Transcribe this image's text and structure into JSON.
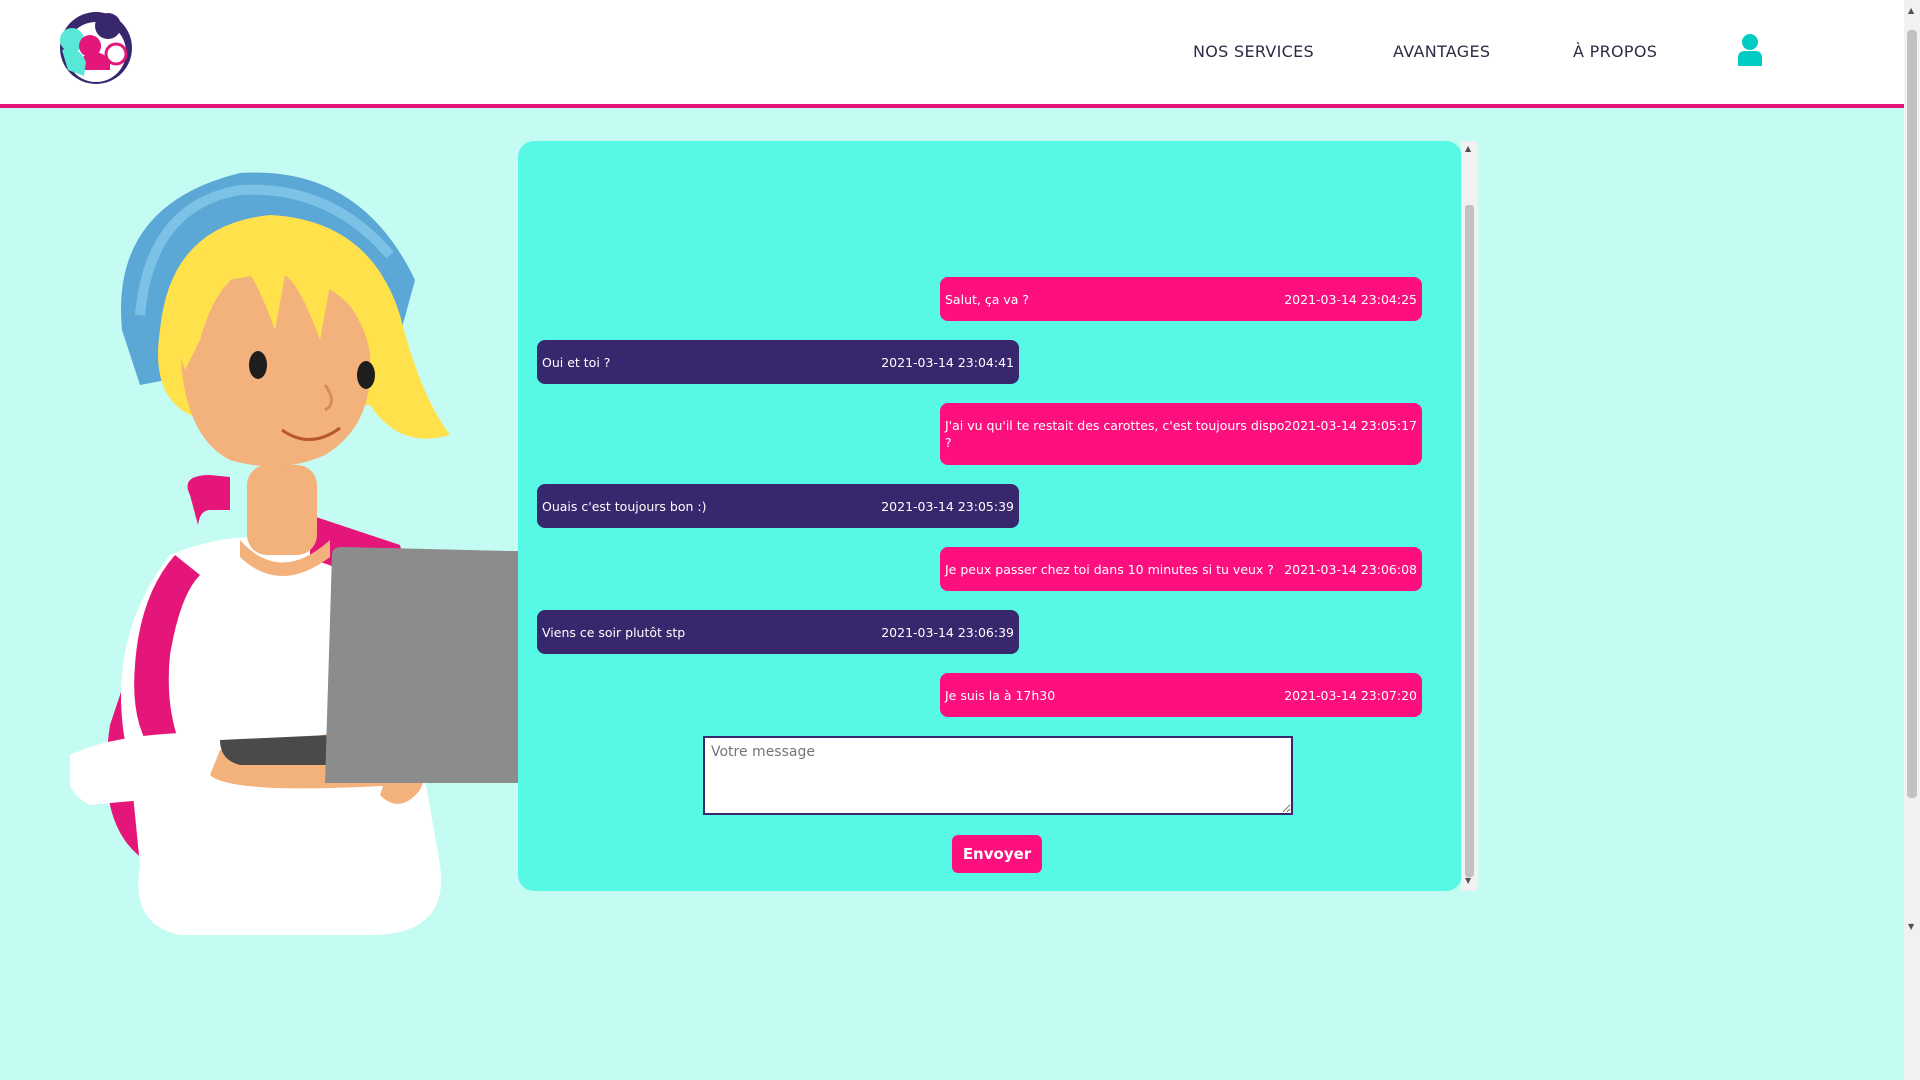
{
  "header": {
    "nav": {
      "services": "NOS SERVICES",
      "avantages": "AVANTAGES",
      "apropos": "À PROPOS"
    },
    "user_icon": "user-icon",
    "logo_icon": "app-logo"
  },
  "chat": {
    "messages": [
      {
        "direction": "sent",
        "text": "Salut, ça va ?",
        "time": "2021-03-14 23:04:25"
      },
      {
        "direction": "received",
        "text": "Oui et toi ?",
        "time": "2021-03-14 23:04:41"
      },
      {
        "direction": "sent",
        "text": "J'ai vu qu'il te restait des carottes, c'est toujours dispo ?",
        "time": "2021-03-14 23:05:17"
      },
      {
        "direction": "received",
        "text": "Ouais c'est toujours bon :)",
        "time": "2021-03-14 23:05:39"
      },
      {
        "direction": "sent",
        "text": "Je peux passer chez toi dans 10 minutes si tu veux ?",
        "time": "2021-03-14 23:06:08"
      },
      {
        "direction": "received",
        "text": "Viens ce soir plutôt stp",
        "time": "2021-03-14 23:06:39"
      },
      {
        "direction": "sent",
        "text": "Je suis la à 17h30",
        "time": "2021-03-14 23:07:20"
      }
    ],
    "input_placeholder": "Votre message",
    "send_label": "Envoyer"
  },
  "colors": {
    "accent_pink": "#fe0f7e",
    "accent_purple": "#38276d",
    "panel_cyan": "#57f8e6",
    "page_bg": "#c4fcf4"
  }
}
